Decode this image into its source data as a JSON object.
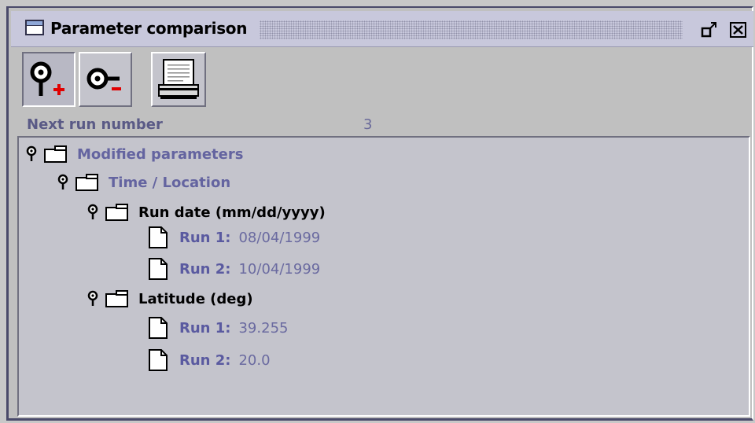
{
  "window": {
    "title": "Parameter comparison"
  },
  "toolbar": {
    "add_run_icon": "pin-add-icon",
    "remove_run_icon": "pin-remove-icon",
    "print_icon": "printer-icon"
  },
  "next_run": {
    "label": "Next run number",
    "value": "3"
  },
  "tree": {
    "root": {
      "label": "Modified parameters"
    },
    "group": {
      "label": "Time / Location"
    },
    "params": [
      {
        "label": "Run date (mm/dd/yyyy)",
        "runs": [
          {
            "key": "Run 1:",
            "value": "08/04/1999"
          },
          {
            "key": "Run 2:",
            "value": "10/04/1999"
          }
        ]
      },
      {
        "label": "Latitude (deg)",
        "runs": [
          {
            "key": "Run 1:",
            "value": "39.255"
          },
          {
            "key": "Run 2:",
            "value": "20.0"
          }
        ]
      }
    ]
  }
}
